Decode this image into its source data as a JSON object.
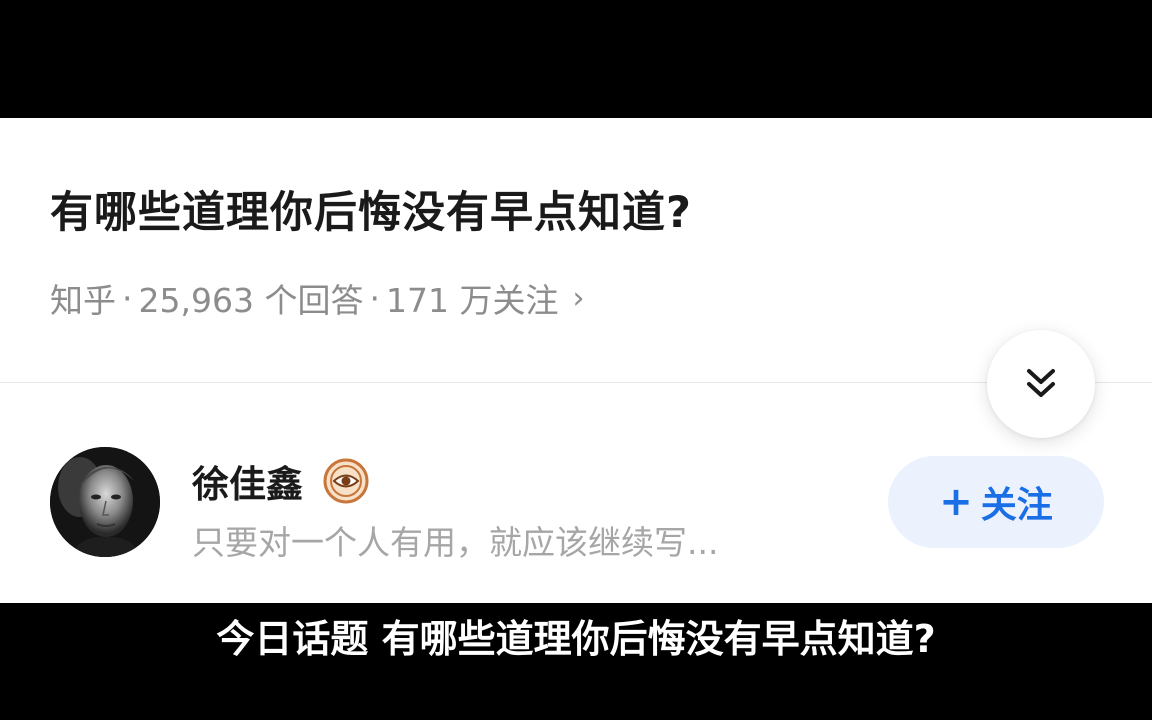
{
  "question": {
    "title": "有哪些道理你后悔没有早点知道?",
    "source": "知乎",
    "separator": "·",
    "answers": "25,963 个回答",
    "followers": "171 万关注",
    "chevron": "›"
  },
  "collapse_button": {
    "icon": "double-chevron-down-icon"
  },
  "author": {
    "name": "徐佳鑫",
    "bio": "只要对一个人有用，就应该继续写...",
    "badge_icon": "eye-badge-icon",
    "badge_color": "#c8763a"
  },
  "follow_button": {
    "plus": "+",
    "label": "关注",
    "text_color": "#1a6ee6",
    "bg_color": "#ebf2fd"
  },
  "subtitle": {
    "text": "今日话题 有哪些道理你后悔没有早点知道?"
  }
}
